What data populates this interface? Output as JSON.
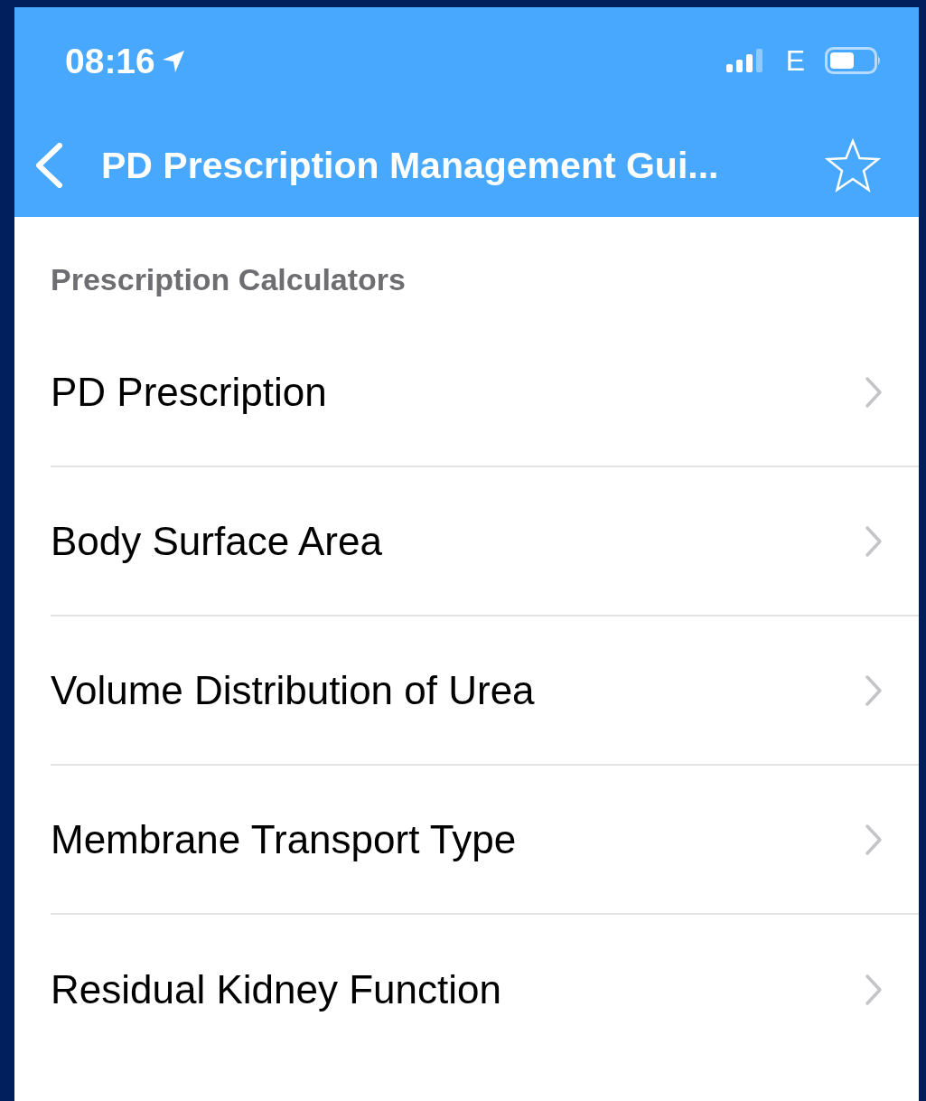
{
  "status_bar": {
    "time": "08:16",
    "network": "E"
  },
  "nav_bar": {
    "title": "PD Prescription Management Gui..."
  },
  "section": {
    "title": "Prescription Calculators"
  },
  "items": [
    {
      "label": "PD Prescription"
    },
    {
      "label": "Body Surface Area"
    },
    {
      "label": "Volume Distribution of Urea"
    },
    {
      "label": "Membrane Transport Type"
    },
    {
      "label": "Residual Kidney Function"
    }
  ]
}
